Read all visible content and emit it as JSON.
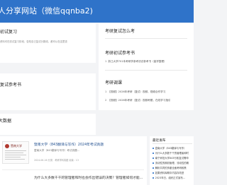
{
  "header": {
    "site_title": "人分享网站（微信qqnba2)"
  },
  "left_cards": {
    "card1": {
      "title": "初试复习",
      "desc": "资料可在初试复习阶段，告知自己复试分数线，都可以在这里查"
    },
    "card2": {
      "title": "复试参考书"
    },
    "card3": {
      "title": "大数据"
    }
  },
  "right_card": {
    "title_search": "考研复试怎么考",
    "title_books": "考研初试参考书",
    "books_items": [
      {
        "num": "1",
        "text": "浙江大学701本考研学参考初试参考书（高学整理）"
      }
    ],
    "title_tuning": "考研调课",
    "tuning_items": [
      {
        "num": "1",
        "text": "【视频】2026年考研（复试）视频，视频合作学习"
      },
      {
        "num": "2",
        "text": "【视频】2026年考研（复试）视频考题，在线学习指引"
      }
    ]
  },
  "article": {
    "thumb_header": "暨南大学",
    "title": "暨南大学（843翻译与写作）2024年考试真题",
    "desc": "暨南大学（843翻译与写作）考试真题...",
    "meta": "2024-06-16  分类：考研学科真题  阅读：13",
    "second_title": "为什么大多数千千的管理者和时也会作出错误的决策？管理者如何才能..."
  },
  "recent": {
    "title": "最近发布",
    "items": [
      "暨南大学（843翻译与写作）",
      "为什么大多数千千的管理者和时",
      "南宁师范大学843行政复试需申",
      "流动性的期初管理，流动性的期",
      "解析共同的多副全面考研政策",
      "如果资料库期中内容存改进",
      "2023年日，组织正式宣布..."
    ]
  }
}
